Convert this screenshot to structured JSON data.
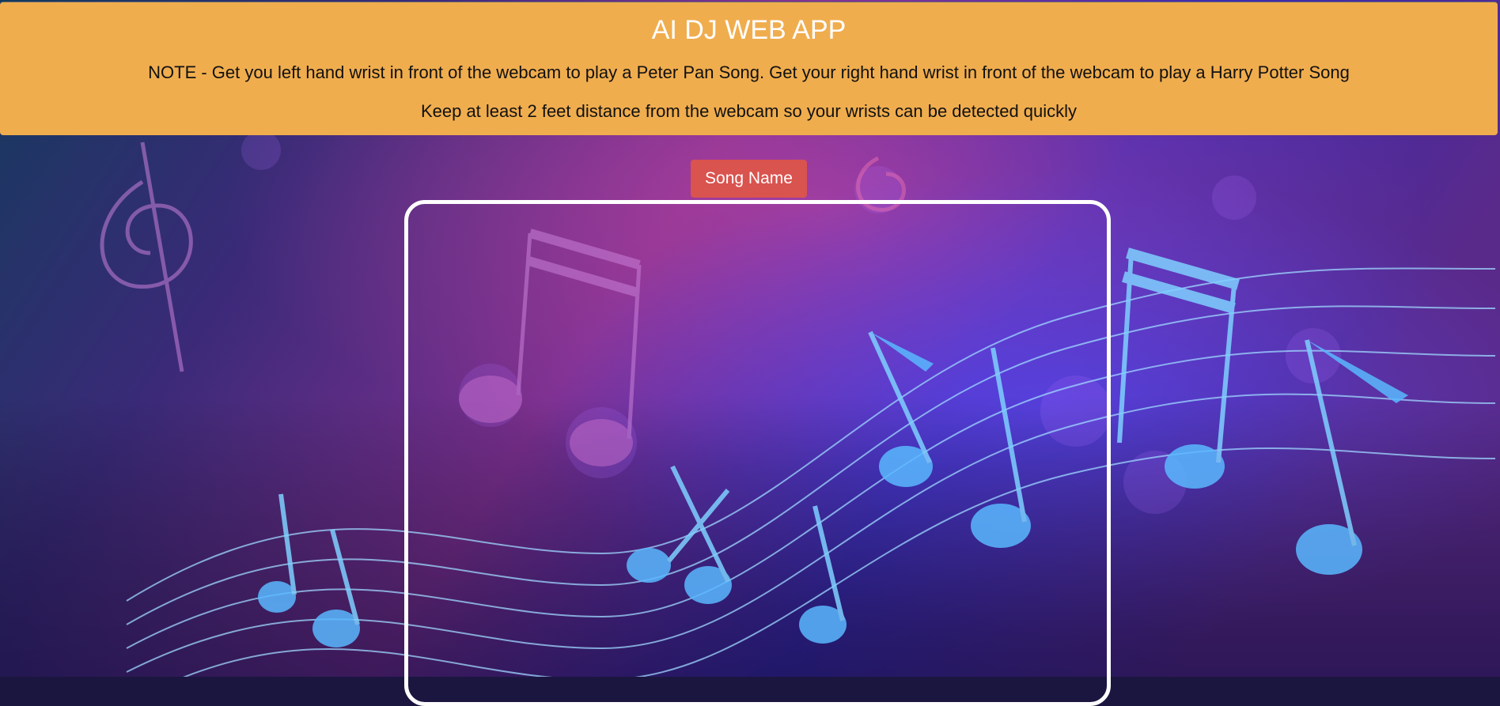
{
  "header": {
    "title": "AI DJ WEB APP",
    "note": "NOTE - Get you left hand wrist in front of the webcam to play a Peter Pan Song. Get your right hand wrist in front of the webcam to play a Harry Potter Song",
    "distance_note": "Keep at least 2 feet distance from the webcam so your wrists can be detected quickly"
  },
  "song_button": {
    "label": "Song Name"
  },
  "colors": {
    "header_bg": "#f0ad4e",
    "button_bg": "#d9534f",
    "frame_border": "#ffffff"
  },
  "icons": [
    "music-notes-background"
  ]
}
